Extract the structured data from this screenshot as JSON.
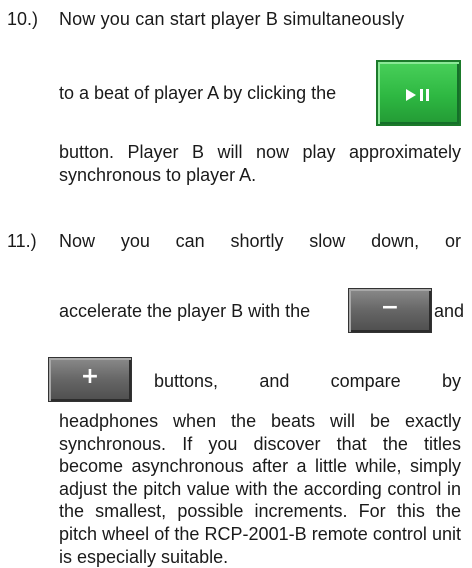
{
  "steps": [
    {
      "number": "10.)",
      "line1": "Now you can start player B simultaneously",
      "line2": "to a beat of player A by clicking the",
      "continuation": "button. Player B will now play approximately synchronous to player A.",
      "play_button": {
        "icon": "play-pause-icon",
        "color": "#2eb842"
      }
    },
    {
      "number": "11.)",
      "line1_words": [
        "Now",
        "you",
        "can",
        "shortly",
        "slow",
        "down,",
        "or"
      ],
      "line2_pre": "accelerate the player B with the",
      "line2_post": "and",
      "line3_words": [
        "buttons,",
        "and",
        "compare",
        "by"
      ],
      "continuation": "headphones when the beats will be exactly synchronous. If you discover that the titles become asynchronous after a little while, simply adjust the pitch value with the according control in the smallest, possible increments. For this the pitch wheel of the RCP-2001-B remote control unit is especially suitable.",
      "minus_button": {
        "label": "−",
        "color": "#666666"
      },
      "plus_button": {
        "label": "+",
        "color": "#666666"
      }
    }
  ]
}
